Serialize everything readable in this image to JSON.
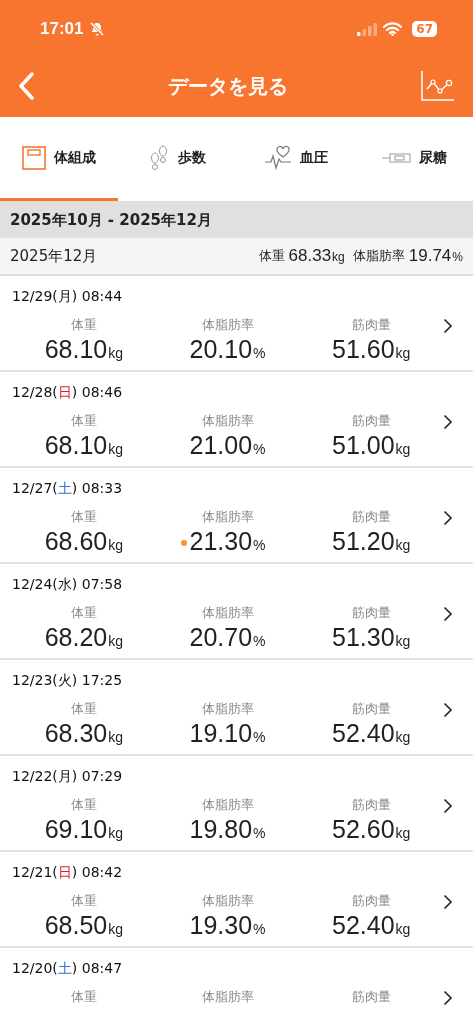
{
  "status_bar": {
    "time": "17:01",
    "battery": "67"
  },
  "header": {
    "title": "データを見る"
  },
  "tabs": [
    {
      "label": "体組成",
      "kind": "scale",
      "selected": true
    },
    {
      "label": "歩数",
      "kind": "steps",
      "selected": false
    },
    {
      "label": "血圧",
      "kind": "heart",
      "selected": false
    },
    {
      "label": "尿糖",
      "kind": "meter",
      "selected": false
    }
  ],
  "range": "2025年10月 - 2025年12月",
  "month_summary": {
    "month": "2025年12月",
    "items": [
      {
        "label": "体重",
        "value": "68.33",
        "unit": "kg"
      },
      {
        "label": "体脂肪率",
        "value": "19.74",
        "unit": "%"
      }
    ]
  },
  "records": [
    {
      "date": "12/29(",
      "weekday": "月",
      "time": ") 08:44",
      "metrics": [
        {
          "label": "体重",
          "value": "68.10",
          "unit": "kg",
          "flag": false
        },
        {
          "label": "体脂肪率",
          "value": "20.10",
          "unit": "%",
          "flag": false
        },
        {
          "label": "筋肉量",
          "value": "51.60",
          "unit": "kg",
          "flag": false
        }
      ]
    },
    {
      "date": "12/28(",
      "weekday": "日",
      "color": "#e02020",
      "time": ") 08:46",
      "metrics": [
        {
          "label": "体重",
          "value": "68.10",
          "unit": "kg",
          "flag": false
        },
        {
          "label": "体脂肪率",
          "value": "21.00",
          "unit": "%",
          "flag": false
        },
        {
          "label": "筋肉量",
          "value": "51.00",
          "unit": "kg",
          "flag": false
        }
      ]
    },
    {
      "date": "12/27(",
      "weekday": "土",
      "color": "#3a6ed0",
      "time": ") 08:33",
      "metrics": [
        {
          "label": "体重",
          "value": "68.60",
          "unit": "kg",
          "flag": false
        },
        {
          "label": "体脂肪率",
          "value": "21.30",
          "unit": "%",
          "flag": true
        },
        {
          "label": "筋肉量",
          "value": "51.20",
          "unit": "kg",
          "flag": false
        }
      ]
    },
    {
      "date": "12/24(",
      "weekday": "水",
      "time": ") 07:58",
      "metrics": [
        {
          "label": "体重",
          "value": "68.20",
          "unit": "kg",
          "flag": false
        },
        {
          "label": "体脂肪率",
          "value": "20.70",
          "unit": "%",
          "flag": false
        },
        {
          "label": "筋肉量",
          "value": "51.30",
          "unit": "kg",
          "flag": false
        }
      ]
    },
    {
      "date": "12/23(",
      "weekday": "火",
      "time": ") 17:25",
      "metrics": [
        {
          "label": "体重",
          "value": "68.30",
          "unit": "kg",
          "flag": false
        },
        {
          "label": "体脂肪率",
          "value": "19.10",
          "unit": "%",
          "flag": false
        },
        {
          "label": "筋肉量",
          "value": "52.40",
          "unit": "kg",
          "flag": false
        }
      ]
    },
    {
      "date": "12/22(",
      "weekday": "月",
      "time": ") 07:29",
      "metrics": [
        {
          "label": "体重",
          "value": "69.10",
          "unit": "kg",
          "flag": false
        },
        {
          "label": "体脂肪率",
          "value": "19.80",
          "unit": "%",
          "flag": false
        },
        {
          "label": "筋肉量",
          "value": "52.60",
          "unit": "kg",
          "flag": false
        }
      ]
    },
    {
      "date": "12/21(",
      "weekday": "日",
      "color": "#e02020",
      "time": ") 08:42",
      "metrics": [
        {
          "label": "体重",
          "value": "68.50",
          "unit": "kg",
          "flag": false
        },
        {
          "label": "体脂肪率",
          "value": "19.30",
          "unit": "%",
          "flag": false
        },
        {
          "label": "筋肉量",
          "value": "52.40",
          "unit": "kg",
          "flag": false
        }
      ]
    },
    {
      "date": "12/20(",
      "weekday": "土",
      "color": "#3a6ed0",
      "time": ") 08:47",
      "metrics": [
        {
          "label": "体重"
        },
        {
          "label": "体脂肪率"
        },
        {
          "label": "筋肉量"
        }
      ]
    }
  ]
}
